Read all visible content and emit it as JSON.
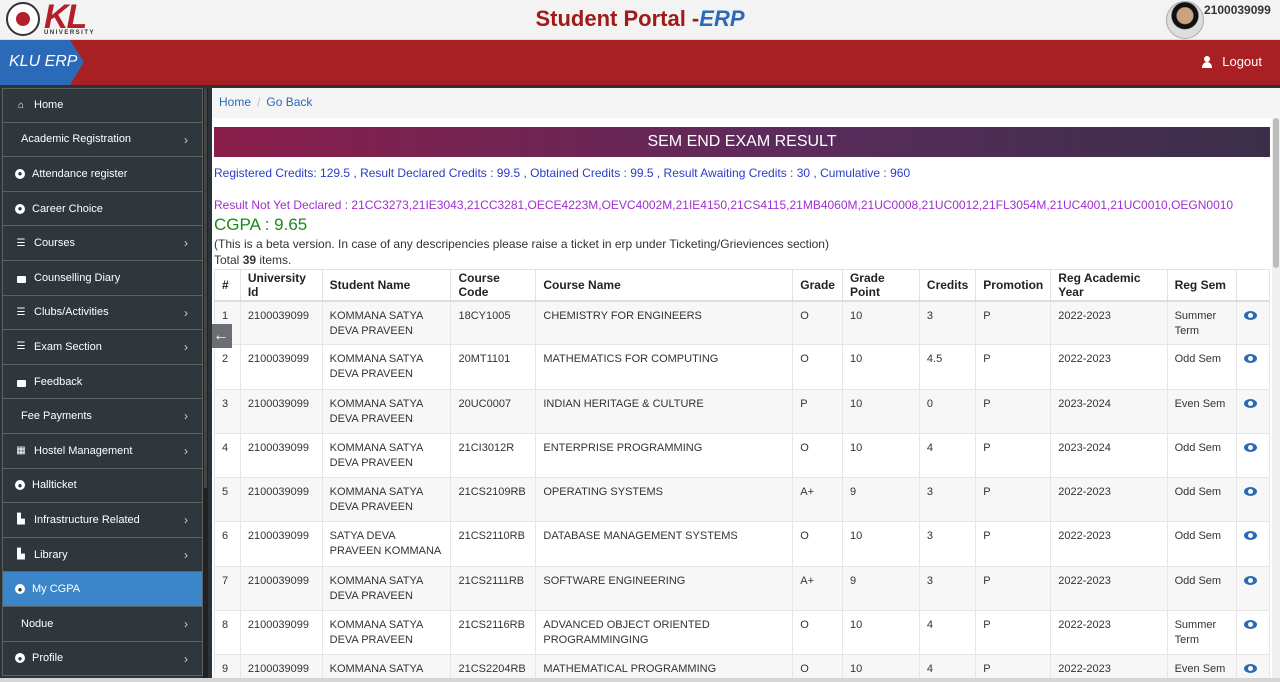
{
  "header": {
    "logo_text": "KL",
    "logo_sub": "UNIVERSITY",
    "title_main": "Student Portal -",
    "title_accent": "ERP",
    "user_id": "2100039099"
  },
  "navbar": {
    "brand": "KLU ERP",
    "logout_label": "Logout"
  },
  "sidebar": {
    "items": [
      {
        "label": "Home",
        "icon": "home-icon",
        "glyph": "⌂",
        "chevron": false
      },
      {
        "label": "Academic Registration",
        "icon": "",
        "glyph": "",
        "chevron": true
      },
      {
        "label": "Attendance register",
        "icon": "clock-icon",
        "glyph": "●",
        "chevron": false
      },
      {
        "label": "Career Choice",
        "icon": "clock-icon",
        "glyph": "●",
        "chevron": false
      },
      {
        "label": "Courses",
        "icon": "list-icon",
        "glyph": "☰",
        "chevron": true
      },
      {
        "label": "Counselling Diary",
        "icon": "lock-icon",
        "glyph": "",
        "chevron": false
      },
      {
        "label": "Clubs/Activities",
        "icon": "list-icon",
        "glyph": "☰",
        "chevron": true
      },
      {
        "label": "Exam Section",
        "icon": "list-icon",
        "glyph": "☰",
        "chevron": true
      },
      {
        "label": "Feedback",
        "icon": "lock-icon",
        "glyph": "",
        "chevron": false
      },
      {
        "label": "Fee Payments",
        "icon": "",
        "glyph": "",
        "chevron": true
      },
      {
        "label": "Hostel Management",
        "icon": "building-icon",
        "glyph": "▦",
        "chevron": true
      },
      {
        "label": "Hallticket",
        "icon": "clock-icon",
        "glyph": "●",
        "chevron": false
      },
      {
        "label": "Infrastructure Related",
        "icon": "chart-icon",
        "glyph": "▙",
        "chevron": true
      },
      {
        "label": "Library",
        "icon": "chart-icon",
        "glyph": "▙",
        "chevron": true
      },
      {
        "label": "My CGPA",
        "icon": "clock-icon",
        "glyph": "●",
        "chevron": false,
        "active": true
      },
      {
        "label": "Nodue",
        "icon": "",
        "glyph": "",
        "chevron": true
      },
      {
        "label": "Profile",
        "icon": "user-circle-icon",
        "glyph": "●",
        "chevron": true
      }
    ]
  },
  "breadcrumb": {
    "home": "Home",
    "back": "Go Back"
  },
  "result": {
    "title": "SEM END EXAM RESULT",
    "credits_line": "Registered Credits: 129.5 , Result Declared Credits : 99.5 , Obtained Credits : 99.5 , Result Awaiting Credits : 30 ,    Cumulative : 960",
    "pending_line": "Result Not Yet Declared : 21CC3273,21IE3043,21CC3281,OECE4223M,OEVC4002M,21IE4150,21CS4115,21MB4060M,21UC0008,21UC0012,21FL3054M,21UC4001,21UC0010,OEGN0010",
    "cgpa_label": "CGPA : 9.65",
    "beta_note": "(This is a beta version. In case of any descripencies please raise a ticket in erp under Ticketing/Grieviences section)",
    "total_prefix": "Total ",
    "total_count": "39",
    "total_suffix": " items."
  },
  "table": {
    "headers": [
      "#",
      "University Id",
      "Student Name",
      "Course Code",
      "Course Name",
      "Grade",
      "Grade Point",
      "Credits",
      "Promotion",
      "Reg Academic Year",
      "Reg Sem",
      ""
    ],
    "rows": [
      [
        "1",
        "2100039099",
        "KOMMANA SATYA DEVA PRAVEEN",
        "18CY1005",
        "CHEMISTRY FOR ENGINEERS",
        "O",
        "10",
        "3",
        "P",
        "2022-2023",
        "Summer Term"
      ],
      [
        "2",
        "2100039099",
        "KOMMANA SATYA DEVA PRAVEEN",
        "20MT1101",
        "MATHEMATICS FOR COMPUTING",
        "O",
        "10",
        "4.5",
        "P",
        "2022-2023",
        "Odd Sem"
      ],
      [
        "3",
        "2100039099",
        "KOMMANA SATYA DEVA PRAVEEN",
        "20UC0007",
        "INDIAN HERITAGE & CULTURE",
        "P",
        "10",
        "0",
        "P",
        "2023-2024",
        "Even Sem"
      ],
      [
        "4",
        "2100039099",
        "KOMMANA SATYA DEVA PRAVEEN",
        "21CI3012R",
        "ENTERPRISE PROGRAMMING",
        "O",
        "10",
        "4",
        "P",
        "2023-2024",
        "Odd Sem"
      ],
      [
        "5",
        "2100039099",
        "KOMMANA SATYA DEVA PRAVEEN",
        "21CS2109RB",
        "OPERATING SYSTEMS",
        "A+",
        "9",
        "3",
        "P",
        "2022-2023",
        "Odd Sem"
      ],
      [
        "6",
        "2100039099",
        "SATYA DEVA PRAVEEN KOMMANA",
        "21CS2110RB",
        "DATABASE MANAGEMENT SYSTEMS",
        "O",
        "10",
        "3",
        "P",
        "2022-2023",
        "Odd Sem"
      ],
      [
        "7",
        "2100039099",
        "KOMMANA SATYA DEVA PRAVEEN",
        "21CS2111RB",
        "SOFTWARE ENGINEERING",
        "A+",
        "9",
        "3",
        "P",
        "2022-2023",
        "Odd Sem"
      ],
      [
        "8",
        "2100039099",
        "KOMMANA SATYA DEVA PRAVEEN",
        "21CS2116RB",
        "ADVANCED OBJECT ORIENTED PROGRAMMINGING",
        "O",
        "10",
        "4",
        "P",
        "2022-2023",
        "Summer Term"
      ],
      [
        "9",
        "2100039099",
        "KOMMANA SATYA",
        "21CS2204RB",
        "MATHEMATICAL PROGRAMMING",
        "O",
        "10",
        "4",
        "P",
        "2022-2023",
        "Even Sem"
      ]
    ]
  },
  "colors": {
    "brand_red": "#a81f24",
    "accent_blue": "#2a6ab8",
    "cgpa_green": "#1a8a1a",
    "pending_purple": "#a12ed1"
  }
}
